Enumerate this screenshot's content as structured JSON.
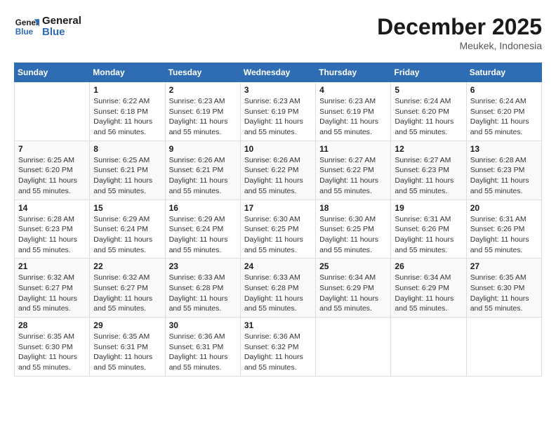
{
  "header": {
    "logo_line1": "General",
    "logo_line2": "Blue",
    "month": "December 2025",
    "location": "Meukek, Indonesia"
  },
  "weekdays": [
    "Sunday",
    "Monday",
    "Tuesday",
    "Wednesday",
    "Thursday",
    "Friday",
    "Saturday"
  ],
  "weeks": [
    [
      {
        "day": "",
        "info": ""
      },
      {
        "day": "1",
        "info": "Sunrise: 6:22 AM\nSunset: 6:18 PM\nDaylight: 11 hours\nand 56 minutes."
      },
      {
        "day": "2",
        "info": "Sunrise: 6:23 AM\nSunset: 6:19 PM\nDaylight: 11 hours\nand 55 minutes."
      },
      {
        "day": "3",
        "info": "Sunrise: 6:23 AM\nSunset: 6:19 PM\nDaylight: 11 hours\nand 55 minutes."
      },
      {
        "day": "4",
        "info": "Sunrise: 6:23 AM\nSunset: 6:19 PM\nDaylight: 11 hours\nand 55 minutes."
      },
      {
        "day": "5",
        "info": "Sunrise: 6:24 AM\nSunset: 6:20 PM\nDaylight: 11 hours\nand 55 minutes."
      },
      {
        "day": "6",
        "info": "Sunrise: 6:24 AM\nSunset: 6:20 PM\nDaylight: 11 hours\nand 55 minutes."
      }
    ],
    [
      {
        "day": "7",
        "info": "Sunrise: 6:25 AM\nSunset: 6:20 PM\nDaylight: 11 hours\nand 55 minutes."
      },
      {
        "day": "8",
        "info": "Sunrise: 6:25 AM\nSunset: 6:21 PM\nDaylight: 11 hours\nand 55 minutes."
      },
      {
        "day": "9",
        "info": "Sunrise: 6:26 AM\nSunset: 6:21 PM\nDaylight: 11 hours\nand 55 minutes."
      },
      {
        "day": "10",
        "info": "Sunrise: 6:26 AM\nSunset: 6:22 PM\nDaylight: 11 hours\nand 55 minutes."
      },
      {
        "day": "11",
        "info": "Sunrise: 6:27 AM\nSunset: 6:22 PM\nDaylight: 11 hours\nand 55 minutes."
      },
      {
        "day": "12",
        "info": "Sunrise: 6:27 AM\nSunset: 6:23 PM\nDaylight: 11 hours\nand 55 minutes."
      },
      {
        "day": "13",
        "info": "Sunrise: 6:28 AM\nSunset: 6:23 PM\nDaylight: 11 hours\nand 55 minutes."
      }
    ],
    [
      {
        "day": "14",
        "info": "Sunrise: 6:28 AM\nSunset: 6:23 PM\nDaylight: 11 hours\nand 55 minutes."
      },
      {
        "day": "15",
        "info": "Sunrise: 6:29 AM\nSunset: 6:24 PM\nDaylight: 11 hours\nand 55 minutes."
      },
      {
        "day": "16",
        "info": "Sunrise: 6:29 AM\nSunset: 6:24 PM\nDaylight: 11 hours\nand 55 minutes."
      },
      {
        "day": "17",
        "info": "Sunrise: 6:30 AM\nSunset: 6:25 PM\nDaylight: 11 hours\nand 55 minutes."
      },
      {
        "day": "18",
        "info": "Sunrise: 6:30 AM\nSunset: 6:25 PM\nDaylight: 11 hours\nand 55 minutes."
      },
      {
        "day": "19",
        "info": "Sunrise: 6:31 AM\nSunset: 6:26 PM\nDaylight: 11 hours\nand 55 minutes."
      },
      {
        "day": "20",
        "info": "Sunrise: 6:31 AM\nSunset: 6:26 PM\nDaylight: 11 hours\nand 55 minutes."
      }
    ],
    [
      {
        "day": "21",
        "info": "Sunrise: 6:32 AM\nSunset: 6:27 PM\nDaylight: 11 hours\nand 55 minutes."
      },
      {
        "day": "22",
        "info": "Sunrise: 6:32 AM\nSunset: 6:27 PM\nDaylight: 11 hours\nand 55 minutes."
      },
      {
        "day": "23",
        "info": "Sunrise: 6:33 AM\nSunset: 6:28 PM\nDaylight: 11 hours\nand 55 minutes."
      },
      {
        "day": "24",
        "info": "Sunrise: 6:33 AM\nSunset: 6:28 PM\nDaylight: 11 hours\nand 55 minutes."
      },
      {
        "day": "25",
        "info": "Sunrise: 6:34 AM\nSunset: 6:29 PM\nDaylight: 11 hours\nand 55 minutes."
      },
      {
        "day": "26",
        "info": "Sunrise: 6:34 AM\nSunset: 6:29 PM\nDaylight: 11 hours\nand 55 minutes."
      },
      {
        "day": "27",
        "info": "Sunrise: 6:35 AM\nSunset: 6:30 PM\nDaylight: 11 hours\nand 55 minutes."
      }
    ],
    [
      {
        "day": "28",
        "info": "Sunrise: 6:35 AM\nSunset: 6:30 PM\nDaylight: 11 hours\nand 55 minutes."
      },
      {
        "day": "29",
        "info": "Sunrise: 6:35 AM\nSunset: 6:31 PM\nDaylight: 11 hours\nand 55 minutes."
      },
      {
        "day": "30",
        "info": "Sunrise: 6:36 AM\nSunset: 6:31 PM\nDaylight: 11 hours\nand 55 minutes."
      },
      {
        "day": "31",
        "info": "Sunrise: 6:36 AM\nSunset: 6:32 PM\nDaylight: 11 hours\nand 55 minutes."
      },
      {
        "day": "",
        "info": ""
      },
      {
        "day": "",
        "info": ""
      },
      {
        "day": "",
        "info": ""
      }
    ]
  ]
}
